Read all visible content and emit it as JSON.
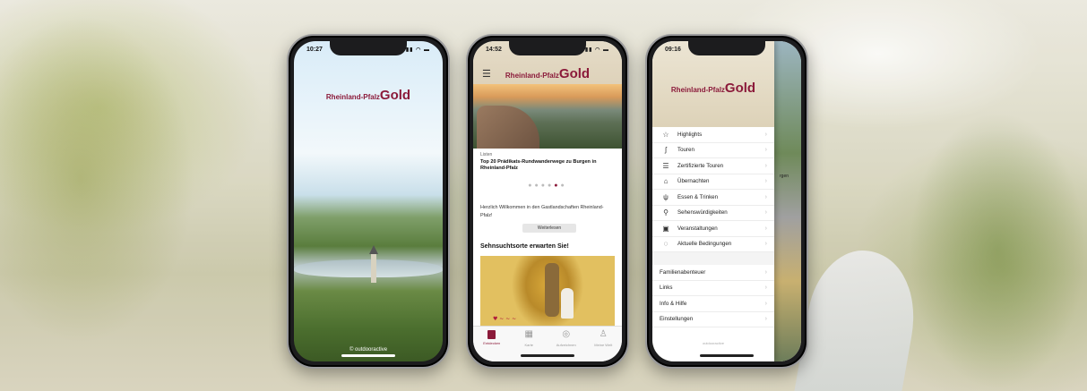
{
  "phone1": {
    "time": "10:27",
    "logo_small": "Rheinland-Pfalz",
    "logo_gold": "Gold",
    "footer": "© outdooractive"
  },
  "phone2": {
    "time": "14:52",
    "logo_small": "Rheinland-Pfalz",
    "logo_gold": "Gold",
    "caption_label": "Listen",
    "caption_title": "Top 20 Prädikats-Rundwanderwege zu Burgen in Rheinland-Pfalz",
    "welcome": "Herzlich Willkommen in den Gastlandschaften Rheinland-Pfalz!",
    "read_more": "Weiterlesen",
    "section_title": "Sehnsuchtsorte erwarten Sie!",
    "carousel": {
      "count": 6,
      "active_index": 5
    },
    "tabs": [
      {
        "label": "Entdecken",
        "icon": "discover-icon"
      },
      {
        "label": "Karte",
        "icon": "map-icon"
      },
      {
        "label": "Aufzeichnen",
        "icon": "record-icon"
      },
      {
        "label": "Meine Welt",
        "icon": "profile-icon"
      }
    ]
  },
  "phone3": {
    "time": "09:16",
    "logo_small": "Rheinland-Pfalz",
    "logo_gold": "Gold",
    "menu_items": [
      {
        "label": "Highlights",
        "icon": "star-icon"
      },
      {
        "label": "Touren",
        "icon": "route-icon"
      },
      {
        "label": "Zertifizierte Touren",
        "icon": "certified-icon"
      },
      {
        "label": "Übernachten",
        "icon": "bed-icon"
      },
      {
        "label": "Essen & Trinken",
        "icon": "cutlery-icon"
      },
      {
        "label": "Sehenswürdigkeiten",
        "icon": "sights-icon"
      },
      {
        "label": "Veranstaltungen",
        "icon": "calendar-icon"
      },
      {
        "label": "Aktuelle Bedingungen",
        "icon": "info-bubble-icon"
      }
    ],
    "secondary_items": [
      {
        "label": "Familienabenteuer"
      },
      {
        "label": "Links"
      },
      {
        "label": "Info & Hilfe"
      },
      {
        "label": "Einstellungen"
      }
    ],
    "footer": "outdooractive",
    "side_text": "rgen"
  },
  "colors": {
    "brand": "#8b1a3a"
  }
}
